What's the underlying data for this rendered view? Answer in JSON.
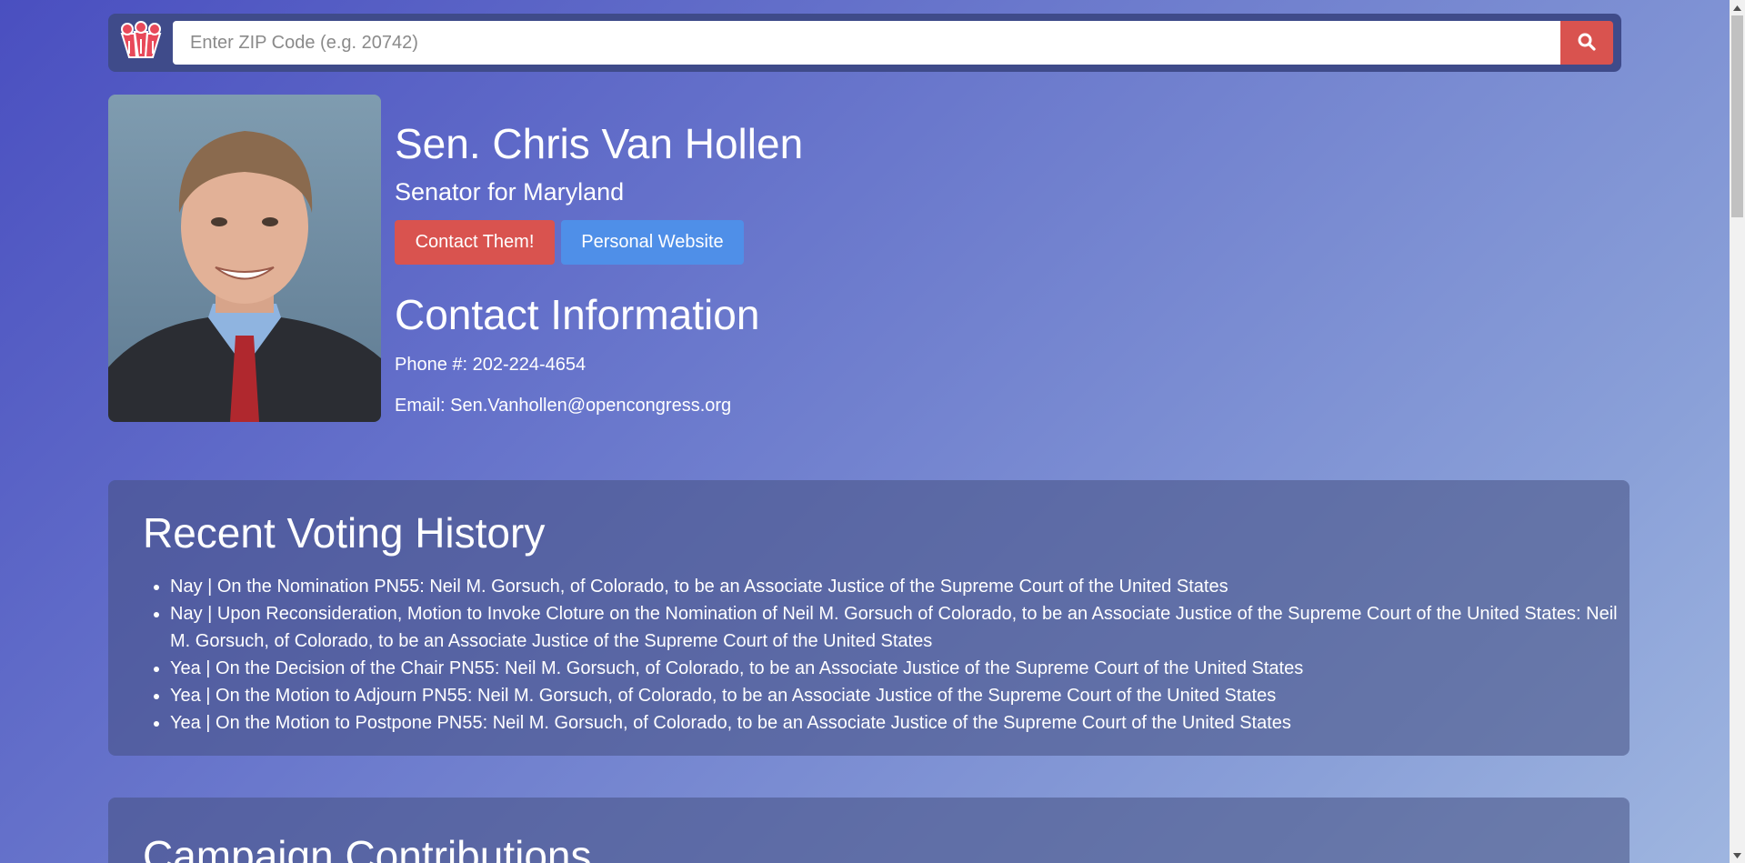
{
  "search": {
    "placeholder": "Enter ZIP Code (e.g. 20742)",
    "logo_icon": "megaphone-group-logo",
    "button_icon": "search-icon",
    "button_color": "#d9534f"
  },
  "profile": {
    "name": "Sen. Chris Van Hollen",
    "subtitle": "Senator for Maryland",
    "contact_button": "Contact Them!",
    "website_button": "Personal Website",
    "contact_button_color": "#d9534f",
    "website_button_color": "#4f8fe8"
  },
  "contact": {
    "heading": "Contact Information",
    "phone": "Phone #: 202-224-4654",
    "email": "Email: Sen.Vanhollen@opencongress.org"
  },
  "voting": {
    "title": "Recent Voting History",
    "items": [
      "Nay | On the Nomination PN55: Neil M. Gorsuch, of Colorado, to be an Associate Justice of the Supreme Court of the United States",
      "Nay | Upon Reconsideration, Motion to Invoke Cloture on the Nomination of Neil M. Gorsuch of Colorado, to be an Associate Justice of the Supreme Court of the United States: Neil M. Gorsuch, of Colorado, to be an Associate Justice of the Supreme Court of the United States",
      "Yea | On the Decision of the Chair PN55: Neil M. Gorsuch, of Colorado, to be an Associate Justice of the Supreme Court of the United States",
      "Yea | On the Motion to Adjourn PN55: Neil M. Gorsuch, of Colorado, to be an Associate Justice of the Supreme Court of the United States",
      "Yea | On the Motion to Postpone PN55: Neil M. Gorsuch, of Colorado, to be an Associate Justice of the Supreme Court of the United States"
    ]
  },
  "contributions": {
    "title": "Campaign Contributions"
  }
}
